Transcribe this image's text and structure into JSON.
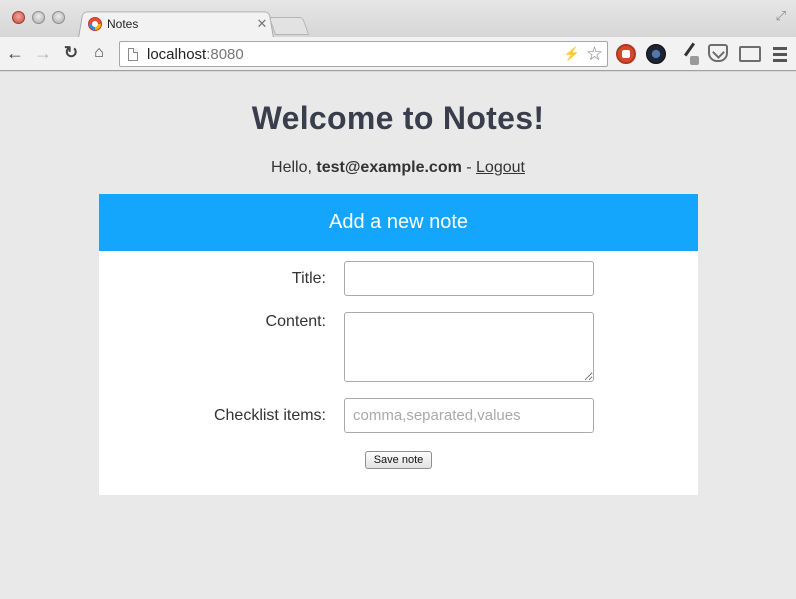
{
  "browser": {
    "tab_title": "Notes",
    "url_host": "localhost",
    "url_port": ":8080"
  },
  "page": {
    "title": "Welcome to Notes!",
    "greeting_prefix": "Hello, ",
    "user_email": "test@example.com",
    "greeting_separator": " - ",
    "logout_label": "Logout"
  },
  "form": {
    "header": "Add a new note",
    "title_label": "Title:",
    "title_value": "",
    "content_label": "Content:",
    "content_value": "",
    "checklist_label": "Checklist items:",
    "checklist_placeholder": "comma,separated,values",
    "save_label": "Save note"
  },
  "colors": {
    "accent": "#14a5fd",
    "title_text": "#3a3e4c",
    "page_background": "#e9e9e9"
  }
}
